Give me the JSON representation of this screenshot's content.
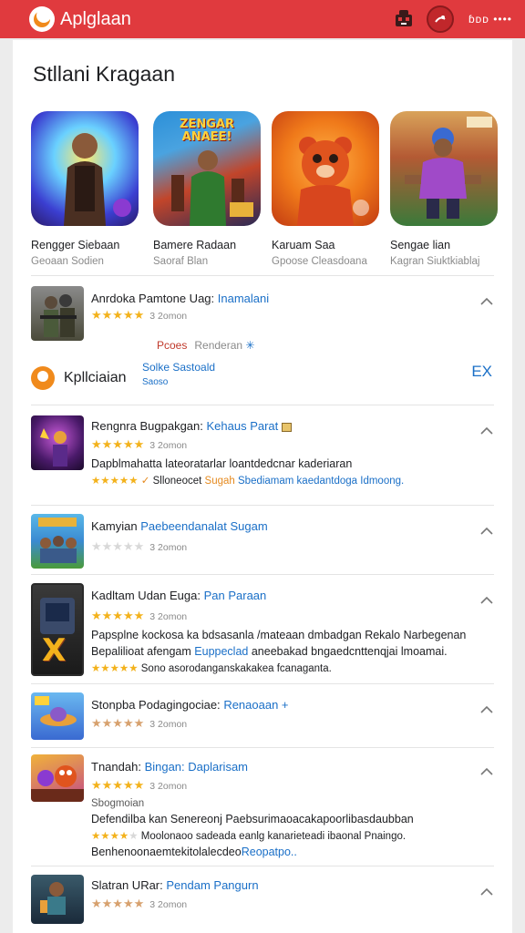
{
  "header": {
    "app_name": "Aplglaan",
    "right_text": "ɓᴅᴅ ••••",
    "brand_color": "#e03a3e"
  },
  "section": {
    "title": "Stllani Kragaan"
  },
  "featured": [
    {
      "name": "Rengger Siebaan",
      "sub": "Geoaan Sodien",
      "icon": "action-hero-icon"
    },
    {
      "name": "Bamere Radaan",
      "sub": "Saoraf Blan",
      "icon": "zengar-action-icon",
      "art_text": "ZENGAR ANAEE!"
    },
    {
      "name": "Karuam Saa",
      "sub": "Gpoose Cleasdoana",
      "icon": "red-bear-icon"
    },
    {
      "name": "Sengae lian",
      "sub": "Kagran Siuktkiablaj",
      "icon": "skater-icon"
    }
  ],
  "rows": [
    {
      "title": "Anrdoka Pamtone Uag:",
      "title_hl": "Inamalani",
      "stars": 5,
      "rating": "3 2omon",
      "icon": "soldier-icon"
    },
    {
      "title": "Rengnra Bugpakgan:",
      "title_hl": "Kehaus Parat",
      "stars": 5,
      "rating": "3 2omon",
      "desc": "Dapblmahatta lateoratarlar loantdedcnar kaderiaran",
      "meta_a": "Slloneocet",
      "meta_b": "Sugah",
      "meta_c": "Sbediamam kaedantdoga Idmoong.",
      "icon": "purple-warrior-icon"
    },
    {
      "title": "Kamyian",
      "title_hl": "Paebeendanalat Sugam",
      "stars": 1,
      "rating": "3 2omon",
      "icon": "squad-icon"
    },
    {
      "title": "Kadltam Udan Euga:",
      "title_hl": "Pan Paraan",
      "stars": 5,
      "rating": "3 2omon",
      "desc": "Papsplne kockosa ka bdsasanla /mateaan dmbadgan Rekalo Narbegenan",
      "desc2_a": "Bepalilioat afengam",
      "desc2_b": "Euppeclad",
      "desc2_c": "aneebakad bngaedcnttenqjai lmoamai.",
      "meta_a": "Sono asorodanganskakakea fcanaganta.",
      "icon": "dark-card-icon",
      "art_text": "X"
    },
    {
      "title": "Stonpba Podagingociae:",
      "title_hl": "Renaoaan +",
      "stars": 5,
      "rating": "3 2omon",
      "icon": "ufo-icon"
    },
    {
      "title": "Tnandah:",
      "title_hl": "Bingan: Daplarisam",
      "stars": 5,
      "rating": "3 2omon",
      "extra": "Sbogmoian",
      "desc": "Defendilba kan Senereonj Paebsurimaoacakapoorlibasdaubban",
      "meta_a": "Moolonaoo sadeada eanlg kanarieteadi ibaonal Pnaingo.",
      "desc3_a": "Benhenoonaemtekitolalecdeo",
      "desc3_b": "Reopatpo..",
      "icon": "monster-squad-icon"
    },
    {
      "title": "Slatran URar:",
      "title_hl": "Pendam Pangurn",
      "stars": 5,
      "rating": "3 2omon",
      "icon": "hero-run-icon"
    }
  ],
  "promo": {
    "tag": "Pcoes",
    "tag_b": "Renderan",
    "name": "Kpllciaian",
    "link": "Solke Sastoald",
    "link_sub": "Saoso",
    "ex": "EX"
  }
}
